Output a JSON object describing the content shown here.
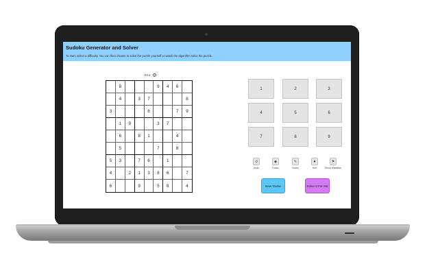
{
  "app": {
    "title": "Sudoku Generator and Solver",
    "subtitle": "To start, select a difficulty. You can then choose to solve the puzzle yourself or watch the algorithm solve the puzzle."
  },
  "difficulty": {
    "label": "D14"
  },
  "board": [
    [
      "",
      "8",
      "",
      "",
      "",
      "9",
      "4",
      "6",
      ""
    ],
    [
      "",
      "4",
      "",
      "3",
      "7",
      "",
      "",
      "",
      "8"
    ],
    [
      "3",
      "",
      "",
      "",
      "8",
      "",
      "",
      "7",
      "9"
    ],
    [
      "",
      "1",
      "9",
      "",
      "",
      "3",
      "7",
      "",
      ""
    ],
    [
      "",
      "6",
      "",
      "8",
      "1",
      "",
      "",
      "4",
      ""
    ],
    [
      "",
      "5",
      "",
      "",
      "",
      "7",
      "",
      "8",
      ""
    ],
    [
      "5",
      "3",
      "",
      "7",
      "6",
      "",
      "1",
      "",
      ""
    ],
    [
      "4",
      "",
      "2",
      "1",
      "3",
      "8",
      "6",
      "",
      "7"
    ],
    [
      "6",
      "",
      "",
      "9",
      "",
      "5",
      "8",
      "",
      "4"
    ]
  ],
  "number_pad": [
    "1",
    "2",
    "3",
    "4",
    "5",
    "6",
    "7",
    "8",
    "9"
  ],
  "tools": [
    {
      "label": "Undo",
      "icon": "undo-icon",
      "glyph": "↺"
    },
    {
      "label": "Erase",
      "icon": "erase-icon",
      "glyph": "◆"
    },
    {
      "label": "Notes",
      "icon": "notes-icon",
      "glyph": "✎"
    },
    {
      "label": "Hint",
      "icon": "hint-icon",
      "glyph": "♦"
    },
    {
      "label": "Show Mistakes",
      "icon": "flag-icon",
      "glyph": "⚑"
    }
  ],
  "actions": {
    "new_game": "New Game",
    "solve": "Solve It For Me"
  },
  "colors": {
    "header": "#8fd0ff",
    "new_game": "#5cc6f5",
    "solve": "#d27bf2"
  }
}
